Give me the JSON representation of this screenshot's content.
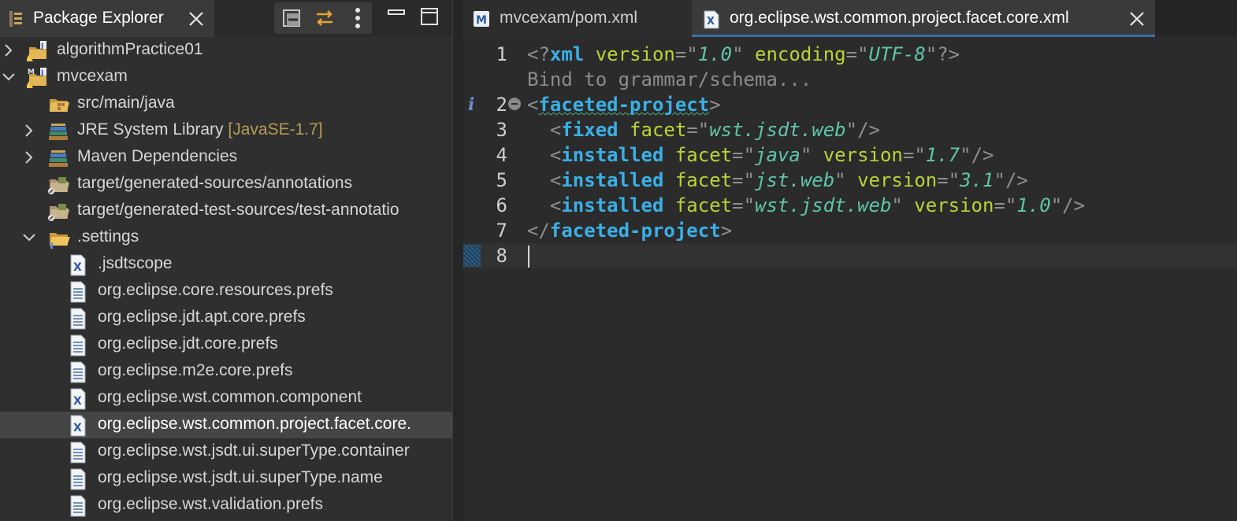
{
  "explorer": {
    "title": "Package Explorer",
    "toolbar": [
      "collapse-all",
      "link-with-editor",
      "view-menu"
    ],
    "tree": [
      {
        "label": "algorithmPractice01",
        "depth": 0,
        "chevron": "right",
        "icon": "project-icon"
      },
      {
        "label": "mvcexam",
        "depth": 0,
        "chevron": "down",
        "icon": "maven-project-icon"
      },
      {
        "label": "src/main/java",
        "depth": 1,
        "chevron": "",
        "icon": "source-folder-icon"
      },
      {
        "label": "JRE System Library ",
        "decoration": "[JavaSE-1.7]",
        "depth": 1,
        "chevron": "right",
        "icon": "library-icon"
      },
      {
        "label": "Maven Dependencies",
        "depth": 1,
        "chevron": "right",
        "icon": "library-icon"
      },
      {
        "label": "target/generated-sources/annotations",
        "depth": 1,
        "chevron": "",
        "icon": "generated-folder-icon"
      },
      {
        "label": "target/generated-test-sources/test-annotatio",
        "depth": 1,
        "chevron": "",
        "icon": "generated-folder-icon"
      },
      {
        "label": ".settings",
        "depth": 1,
        "chevron": "down",
        "icon": "open-folder-icon"
      },
      {
        "label": ".jsdtscope",
        "depth": 2,
        "chevron": "",
        "icon": "xml-file-icon"
      },
      {
        "label": "org.eclipse.core.resources.prefs",
        "depth": 2,
        "chevron": "",
        "icon": "text-file-icon"
      },
      {
        "label": "org.eclipse.jdt.apt.core.prefs",
        "depth": 2,
        "chevron": "",
        "icon": "text-file-icon"
      },
      {
        "label": "org.eclipse.jdt.core.prefs",
        "depth": 2,
        "chevron": "",
        "icon": "text-file-icon"
      },
      {
        "label": "org.eclipse.m2e.core.prefs",
        "depth": 2,
        "chevron": "",
        "icon": "text-file-icon"
      },
      {
        "label": "org.eclipse.wst.common.component",
        "depth": 2,
        "chevron": "",
        "icon": "xml-file-icon"
      },
      {
        "label": "org.eclipse.wst.common.project.facet.core.",
        "depth": 2,
        "chevron": "",
        "icon": "xml-file-icon",
        "selected": true
      },
      {
        "label": "org.eclipse.wst.jsdt.ui.superType.container",
        "depth": 2,
        "chevron": "",
        "icon": "text-file-icon"
      },
      {
        "label": "org.eclipse.wst.jsdt.ui.superType.name",
        "depth": 2,
        "chevron": "",
        "icon": "text-file-icon"
      },
      {
        "label": "org.eclipse.wst.validation.prefs",
        "depth": 2,
        "chevron": "",
        "icon": "text-file-icon"
      }
    ]
  },
  "editor": {
    "tabs": [
      {
        "label": "mvcexam/pom.xml",
        "icon": "maven-pom-icon",
        "active": false
      },
      {
        "label": "org.eclipse.wst.common.project.facet.core.xml",
        "icon": "xml-file-icon",
        "active": true
      }
    ],
    "line_numbers": [
      "1",
      "",
      "2",
      "3",
      "4",
      "5",
      "6",
      "7",
      "8"
    ],
    "lines": [
      [
        [
          "c-punct",
          "<?"
        ],
        [
          "c-tag",
          "xml"
        ],
        [
          "c-attr",
          " version"
        ],
        [
          "c-punct",
          "="
        ],
        [
          "c-punct",
          "\""
        ],
        [
          "c-val",
          "1.0"
        ],
        [
          "c-punct",
          "\""
        ],
        [
          "c-attr",
          " encoding"
        ],
        [
          "c-punct",
          "="
        ],
        [
          "c-punct",
          "\""
        ],
        [
          "c-val",
          "UTF-8"
        ],
        [
          "c-punct",
          "\""
        ],
        [
          "c-punct",
          "?>"
        ]
      ],
      [
        [
          "c-hint",
          "Bind to grammar/schema..."
        ]
      ],
      [
        [
          "c-punct",
          "<"
        ],
        [
          "c-tag squig",
          "faceted-project"
        ],
        [
          "c-punct",
          ">"
        ]
      ],
      [
        [
          "c-punct",
          "  <"
        ],
        [
          "c-tag",
          "fixed"
        ],
        [
          "c-attr",
          " facet"
        ],
        [
          "c-punct",
          "="
        ],
        [
          "c-punct",
          "\""
        ],
        [
          "c-val",
          "wst.jsdt.web"
        ],
        [
          "c-punct",
          "\""
        ],
        [
          "c-punct",
          "/>"
        ]
      ],
      [
        [
          "c-punct",
          "  <"
        ],
        [
          "c-tag",
          "installed"
        ],
        [
          "c-attr",
          " facet"
        ],
        [
          "c-punct",
          "="
        ],
        [
          "c-punct",
          "\""
        ],
        [
          "c-val",
          "java"
        ],
        [
          "c-punct",
          "\""
        ],
        [
          "c-attr",
          " version"
        ],
        [
          "c-punct",
          "="
        ],
        [
          "c-punct",
          "\""
        ],
        [
          "c-val",
          "1.7"
        ],
        [
          "c-punct",
          "\""
        ],
        [
          "c-punct",
          "/>"
        ]
      ],
      [
        [
          "c-punct",
          "  <"
        ],
        [
          "c-tag",
          "installed"
        ],
        [
          "c-attr",
          " facet"
        ],
        [
          "c-punct",
          "="
        ],
        [
          "c-punct",
          "\""
        ],
        [
          "c-val",
          "jst.web"
        ],
        [
          "c-punct",
          "\""
        ],
        [
          "c-attr",
          " version"
        ],
        [
          "c-punct",
          "="
        ],
        [
          "c-punct",
          "\""
        ],
        [
          "c-val",
          "3.1"
        ],
        [
          "c-punct",
          "\""
        ],
        [
          "c-punct",
          "/>"
        ]
      ],
      [
        [
          "c-punct",
          "  <"
        ],
        [
          "c-tag",
          "installed"
        ],
        [
          "c-attr",
          " facet"
        ],
        [
          "c-punct",
          "="
        ],
        [
          "c-punct",
          "\""
        ],
        [
          "c-val",
          "wst.jsdt.web"
        ],
        [
          "c-punct",
          "\""
        ],
        [
          "c-attr",
          " version"
        ],
        [
          "c-punct",
          "="
        ],
        [
          "c-punct",
          "\""
        ],
        [
          "c-val",
          "1.0"
        ],
        [
          "c-punct",
          "\""
        ],
        [
          "c-punct",
          "/>"
        ]
      ],
      [
        [
          "c-punct",
          "</"
        ],
        [
          "c-tag",
          "faceted-project"
        ],
        [
          "c-punct",
          ">"
        ]
      ],
      []
    ],
    "info_marker": "i",
    "colors": {
      "tag": "#3ab0e6",
      "attr": "#b8d437",
      "value": "#5fc5a6",
      "punct": "#8f8f8f",
      "tab_accent": "#3d6fa8"
    }
  }
}
